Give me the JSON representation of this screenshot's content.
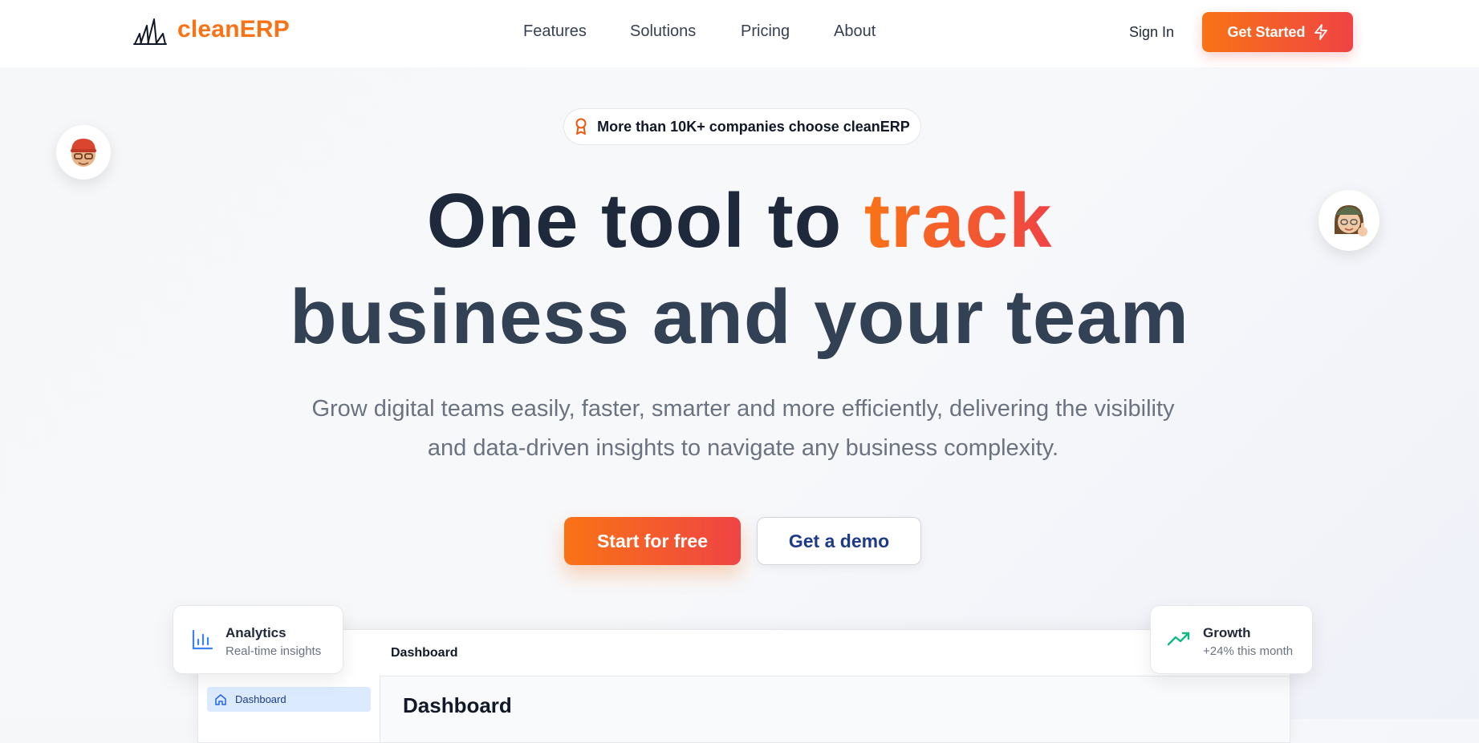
{
  "header": {
    "brand": "cleanERP",
    "nav": [
      "Features",
      "Solutions",
      "Pricing",
      "About"
    ],
    "sign_in": "Sign In",
    "get_started": "Get Started"
  },
  "hero": {
    "badge": "More than 10K+ companies choose cleanERP",
    "headline_part1": "One tool to ",
    "headline_accent": "track",
    "headline_line2": "business and your team",
    "subtitle": "Grow digital teams easily, faster, smarter and more efficiently, delivering the visibility and data-driven insights to navigate any business complexity.",
    "cta_primary": "Start for free",
    "cta_secondary": "Get a demo"
  },
  "dashboard_preview": {
    "sidebar_item": "Dashboard",
    "breadcrumb": "Dashboard",
    "heading": "Dashboard"
  },
  "cards": {
    "analytics": {
      "title": "Analytics",
      "subtitle": "Real-time insights"
    },
    "growth": {
      "title": "Growth",
      "subtitle": "+24% this month"
    }
  },
  "colors": {
    "brand_orange": "#f97316",
    "brand_red": "#ef4444",
    "navy": "#1e3a8a",
    "analytics_icon": "#3b82f6",
    "growth_icon": "#10b981"
  },
  "icons": {
    "logo": "sails-logo-icon",
    "get_started": "lightning-icon",
    "badge": "award-ribbon-icon",
    "analytics": "bar-chart-icon",
    "growth": "trending-up-icon",
    "sidebar_dashboard": "home-icon"
  }
}
